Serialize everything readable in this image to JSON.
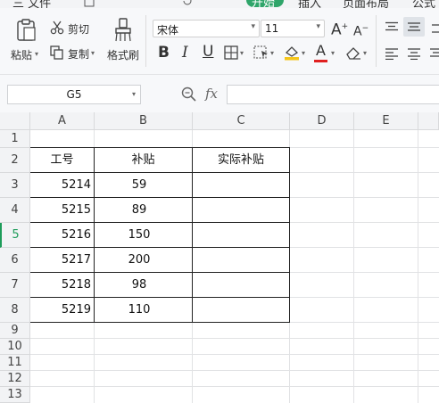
{
  "menu": {
    "file_label": "三 文件",
    "start_tab": "开始",
    "insert_tab": "插入",
    "layout_tab": "页面布局",
    "formula_tab": "公式"
  },
  "ribbon": {
    "paste_label": "粘贴",
    "cut_label": "剪切",
    "copy_label": "复制",
    "format_painter_label": "格式刷",
    "font_name": "宋体",
    "font_size": "11",
    "bold": "B",
    "italic": "I",
    "underline": "U",
    "font_color_glyph": "A",
    "grow_font": "A",
    "shrink_font": "A",
    "accent_green": "#2fa56a",
    "font_color": "#e02020",
    "fill_color": "#f5c518"
  },
  "formula_bar": {
    "name_box": "G5",
    "fx_label": "fx",
    "formula": ""
  },
  "sheet": {
    "columns": [
      "A",
      "B",
      "C",
      "D",
      "E"
    ],
    "rows": [
      "1",
      "2",
      "3",
      "4",
      "5",
      "6",
      "7",
      "8",
      "9",
      "10",
      "11",
      "12",
      "13"
    ],
    "active_row": "5",
    "table": {
      "header": [
        "工号",
        "补贴",
        "实际补贴"
      ],
      "body": [
        [
          "5214",
          "59",
          ""
        ],
        [
          "5215",
          "89",
          ""
        ],
        [
          "5216",
          "150",
          ""
        ],
        [
          "5217",
          "200",
          ""
        ],
        [
          "5218",
          "98",
          ""
        ],
        [
          "5219",
          "110",
          ""
        ]
      ]
    }
  }
}
